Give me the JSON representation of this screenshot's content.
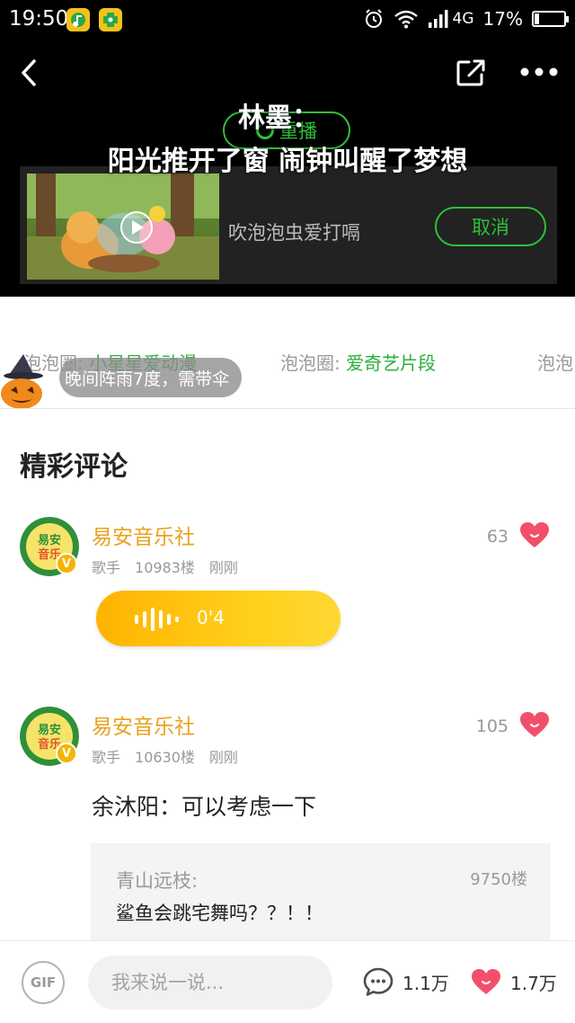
{
  "status_bar": {
    "time": "19:50",
    "network": "4G",
    "battery": "17%",
    "battery_level": 0.17
  },
  "player": {
    "lyric_line1": "林墨：",
    "lyric_line2": "阳光推开了窗 闹钟叫醒了梦想",
    "replay_label": "重播",
    "next_video_title": "吹泡泡虫爱打嗝",
    "cancel_label": "取消"
  },
  "tags": [
    {
      "prefix": "泡泡圈:",
      "value": "小星星爱动漫"
    },
    {
      "prefix": "泡泡圈:",
      "value": "爱奇艺片段"
    },
    {
      "prefix": "泡泡"
    }
  ],
  "weather": {
    "text": "晚间阵雨7度，需带伞"
  },
  "comments_section": {
    "title": "精彩评论",
    "comments": [
      {
        "username": "易安音乐社",
        "role": "歌手",
        "floor": "10983楼",
        "time": "刚刚",
        "likes": "63",
        "voice_duration": "0'4"
      },
      {
        "username": "易安音乐社",
        "role": "歌手",
        "floor": "10630楼",
        "time": "刚刚",
        "likes": "105",
        "text": "余沐阳：可以考虑一下",
        "reply": {
          "username": "青山远枝:",
          "floor": "9750楼",
          "text": "鲨鱼会跳宅舞吗？？！！"
        }
      }
    ]
  },
  "bottom_bar": {
    "gif_label": "GIF",
    "input_placeholder": "我来说一说...",
    "comment_count": "1.1万",
    "like_count": "1.7万"
  },
  "colors": {
    "accent_green": "#2fbf3a",
    "username_orange": "#e9a21d",
    "heart_red": "#f2506a",
    "voice_yellow": "#ffc107"
  }
}
